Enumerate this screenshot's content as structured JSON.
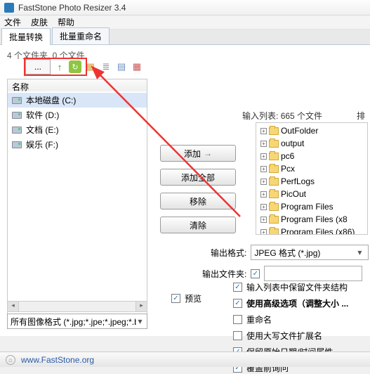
{
  "window": {
    "title": "FastStone Photo Resizer 3.4"
  },
  "menu": {
    "file": "文件",
    "skin": "皮肤",
    "help": "帮助"
  },
  "tabs": {
    "batch_convert": "批量转换",
    "batch_rename": "批量重命名"
  },
  "left": {
    "count_label": "4 个文件夹, 0 个文件",
    "browse_dots": "...",
    "col_name": "名称",
    "drives": [
      {
        "label": "本地磁盘 (C:)"
      },
      {
        "label": "软件 (D:)"
      },
      {
        "label": "文档 (E:)"
      },
      {
        "label": "娱乐 (F:)"
      }
    ],
    "filter_text": "所有图像格式 (*.jpg;*.jpe;*.jpeg;*.bmp;*.gif;*.png)"
  },
  "center": {
    "add": "添加",
    "add_all": "添加全部",
    "remove": "移除",
    "clear": "清除"
  },
  "right": {
    "input_list_label": "输入列表:",
    "input_count": "665 个文件",
    "sort_label": "排",
    "tree": [
      "OutFolder",
      "output",
      "pc6",
      "Pcx",
      "PerfLogs",
      "PicOut",
      "Program Files",
      "Program Files (x8",
      "Program Files (x86)"
    ],
    "out_format_label": "输出格式:",
    "out_format_value": "JPEG 格式 (*.jpg)",
    "out_folder_label": "输出文件夹:",
    "preview_label": "预览",
    "checks": {
      "preserve_struct": "输入列表中保留文件夹结构",
      "use_adv": "使用高级选项（调整大小 ...",
      "rename": "重命名",
      "use_upper": "使用大写文件扩展名",
      "preserve_date": "保留原始日期/时间属性",
      "overwrite": "覆盖前询问"
    }
  },
  "status": {
    "url": "www.FastStone.org"
  }
}
